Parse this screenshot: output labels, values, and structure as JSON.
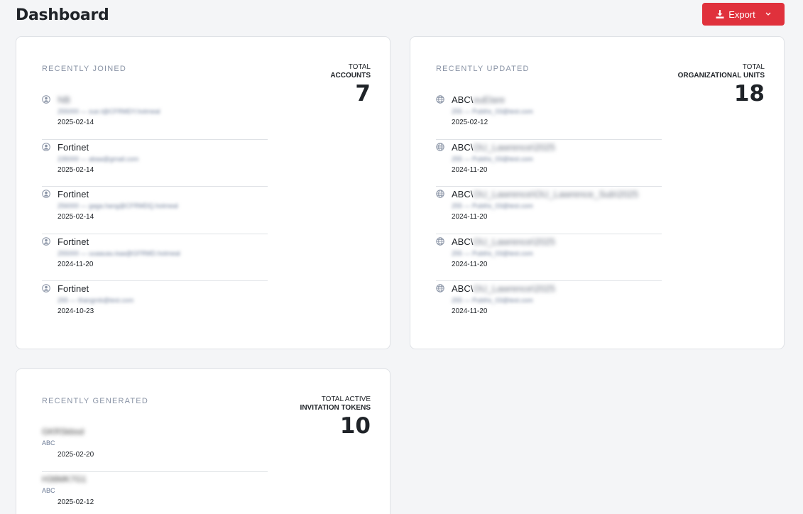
{
  "page": {
    "title": "Dashboard",
    "export_label": "Export"
  },
  "recently_joined": {
    "label": "RECENTLY JOINED",
    "stat_line1": "TOTAL",
    "stat_line2": "ACCOUNTS",
    "stat_value": "7",
    "items": [
      {
        "name": "NB",
        "sub": "255000 — sue.t@CFRMDY.hotmeal",
        "date": "2025-02-14",
        "name_blurred": true
      },
      {
        "name": "Fortinet",
        "sub": "235000 — abaa@gmail.com",
        "date": "2025-02-14",
        "name_blurred": false
      },
      {
        "name": "Fortinet",
        "sub": "256000 — gaga.hang@CFRMDQ.hotmeal",
        "date": "2025-02-14",
        "name_blurred": false
      },
      {
        "name": "Fortinet",
        "sub": "255000 — uuaauau.kaa@GFRMD.hotmeal",
        "date": "2024-11-20",
        "name_blurred": false
      },
      {
        "name": "Fortinet",
        "sub": "255 — thangmb@test.com",
        "date": "2024-10-23",
        "name_blurred": false
      }
    ]
  },
  "recently_updated": {
    "label": "RECENTLY UPDATED",
    "stat_line1": "TOTAL",
    "stat_line2": "ORGANIZATIONAL UNITS",
    "stat_value": "18",
    "items": [
      {
        "prefix": "ABC\\",
        "name_rest": "ouElare",
        "sub": "255 — Pubihs_03@test.com",
        "date": "2025-02-12"
      },
      {
        "prefix": "ABC\\",
        "name_rest": "OU_Lawrence\\2025",
        "sub": "255 — Pubihs_03@test.com",
        "date": "2024-11-20"
      },
      {
        "prefix": "ABC\\",
        "name_rest": "OU_Lawrence\\OU_Lawrence_Sub\\2025",
        "sub": "255 — Pubihs_03@test.com",
        "date": "2024-11-20"
      },
      {
        "prefix": "ABC\\",
        "name_rest": "OU_Lawrence\\2025",
        "sub": "255 — Pubihs_03@test.com",
        "date": "2024-11-20"
      },
      {
        "prefix": "ABC\\",
        "name_rest": "OU_Lawrence\\2025",
        "sub": "255 — Pubihs_03@test.com",
        "date": "2024-11-20"
      }
    ]
  },
  "recently_generated": {
    "label": "RECENTLY GENERATED",
    "stat_line1": "TOTAL ACTIVE",
    "stat_line2": "INVITATION TOKENS",
    "stat_value": "10",
    "items": [
      {
        "token": "GKRSkbsd",
        "org": "ABC",
        "date": "2025-02-20"
      },
      {
        "token": "H38MK7G1",
        "org": "ABC",
        "date": "2025-02-12"
      }
    ]
  },
  "colors": {
    "accent": "#e0313c",
    "background": "#f4f5f7",
    "card_border": "#dfe2e6",
    "muted_label": "#8a94a6"
  },
  "icons": {
    "export": "download-icon",
    "dropdown": "chevron-down-icon",
    "account": "user-circle-icon",
    "org_unit": "globe-icon"
  }
}
